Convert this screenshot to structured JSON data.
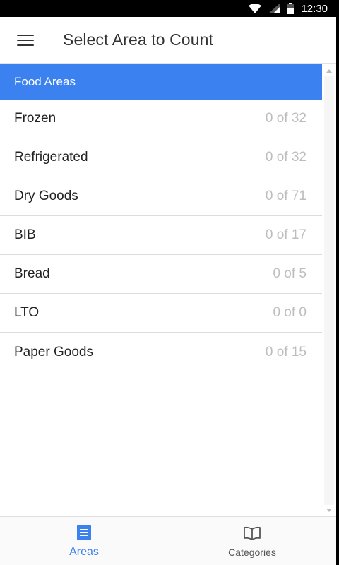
{
  "status_bar": {
    "time": "12:30",
    "icons": [
      "wifi-icon",
      "signal-icon",
      "battery-icon"
    ]
  },
  "app_bar": {
    "title": "Select Area to Count",
    "menu_icon": "hamburger-menu-icon"
  },
  "section": {
    "title": "Food Areas"
  },
  "areas": [
    {
      "name": "Frozen",
      "count": "0 of 32"
    },
    {
      "name": "Refrigerated",
      "count": "0 of 32"
    },
    {
      "name": "Dry Goods",
      "count": "0 of 71"
    },
    {
      "name": "BIB",
      "count": "0 of 17"
    },
    {
      "name": "Bread",
      "count": "0 of 5"
    },
    {
      "name": "LTO",
      "count": "0 of 0"
    },
    {
      "name": "Paper Goods",
      "count": "0 of 15"
    }
  ],
  "bottom_nav": {
    "tabs": [
      {
        "label": "Areas",
        "icon": "list-icon",
        "active": true
      },
      {
        "label": "Categories",
        "icon": "book-icon",
        "active": false
      }
    ]
  },
  "colors": {
    "accent": "#3b82f0",
    "count_text": "#bdbdbd"
  }
}
